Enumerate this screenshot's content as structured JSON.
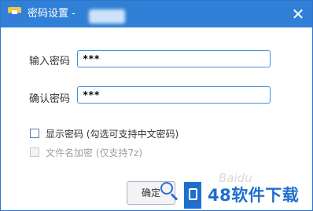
{
  "window": {
    "title": "密码设置 -",
    "close_glyph": "✕"
  },
  "form": {
    "password_label": "输入密码",
    "password_value": "***",
    "confirm_label": "确认密码",
    "confirm_value": "***"
  },
  "options": {
    "show_password": {
      "label": "显示密码 (勾选可支持中文密码)",
      "checked": false,
      "enabled": true
    },
    "encrypt_filenames": {
      "label": "文件名加密 (仅支持7z)",
      "checked": false,
      "enabled": false
    }
  },
  "buttons": {
    "ok_label": "确定"
  },
  "watermark": {
    "brand_text": "48软件下载",
    "faint_text": "Baidu"
  },
  "colors": {
    "titlebar": "#2f80d6",
    "input_border": "#3d8fe0",
    "watermark": "#1e6ecf"
  }
}
